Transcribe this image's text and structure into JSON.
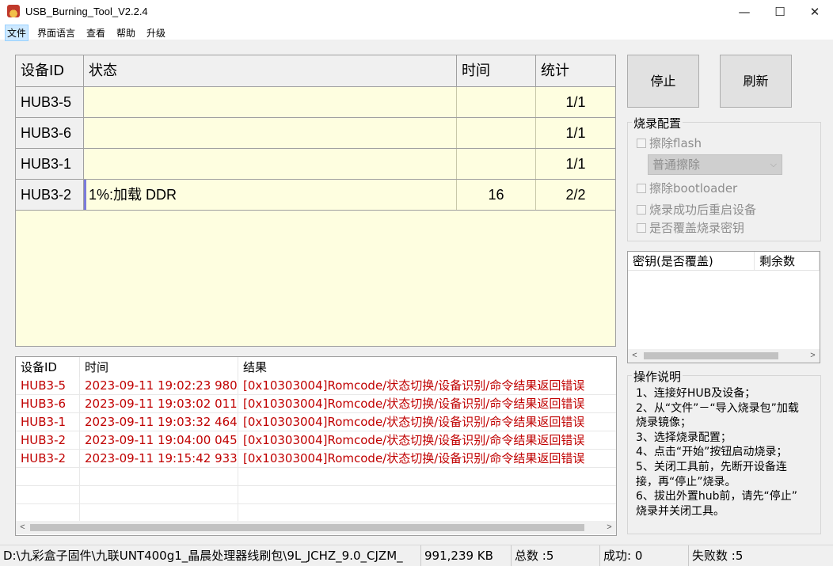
{
  "window": {
    "title": "USB_Burning_Tool_V2.2.4",
    "min_glyph": "—",
    "max_glyph": "☐",
    "close_glyph": "✕"
  },
  "menu": [
    "文件",
    "界面语言",
    "查看",
    "帮助",
    "升级"
  ],
  "device_table": {
    "headers": [
      "设备ID",
      "状态",
      "时间",
      "统计"
    ],
    "rows": [
      {
        "id": "HUB3-5",
        "status": "",
        "time": "",
        "stat": "1/1"
      },
      {
        "id": "HUB3-6",
        "status": "",
        "time": "",
        "stat": "1/1"
      },
      {
        "id": "HUB3-1",
        "status": "",
        "time": "",
        "stat": "1/1"
      },
      {
        "id": "HUB3-2",
        "status": "1%:加载 DDR",
        "time": "16",
        "stat": "2/2"
      }
    ]
  },
  "buttons": {
    "stop": "停止",
    "refresh": "刷新"
  },
  "burn_config": {
    "title": "烧录配置",
    "erase_flash": "擦除flash",
    "erase_mode": "普通擦除",
    "erase_bootloader": "擦除bootloader",
    "reboot_after": "烧录成功后重启设备",
    "overwrite_key": "是否覆盖烧录密钥"
  },
  "key_table": {
    "headers": [
      "密钥(是否覆盖)",
      "剩余数"
    ]
  },
  "instructions": {
    "title": "操作说明",
    "lines": [
      "1、连接好HUB及设备；",
      "2、从“文件”－“导入烧录包”加载",
      "烧录镜像；",
      "3、选择烧录配置；",
      "4、点击“开始”按钮启动烧录；",
      "5、关闭工具前，先断开设备连",
      "接，再“停止”烧录。",
      "6、拔出外置hub前，请先“停止”",
      "烧录并关闭工具。"
    ]
  },
  "log_table": {
    "headers": [
      "设备ID",
      "时间",
      "结果"
    ],
    "rows": [
      {
        "id": "HUB3-5",
        "time": "2023-09-11 19:02:23 980",
        "result": "[0x10303004]Romcode/状态切换/设备识别/命令结果返回错误"
      },
      {
        "id": "HUB3-6",
        "time": "2023-09-11 19:03:02 011",
        "result": "[0x10303004]Romcode/状态切换/设备识别/命令结果返回错误"
      },
      {
        "id": "HUB3-1",
        "time": "2023-09-11 19:03:32 464",
        "result": "[0x10303004]Romcode/状态切换/设备识别/命令结果返回错误"
      },
      {
        "id": "HUB3-2",
        "time": "2023-09-11 19:04:00 045",
        "result": "[0x10303004]Romcode/状态切换/设备识别/命令结果返回错误"
      },
      {
        "id": "HUB3-2",
        "time": "2023-09-11 19:15:42 933",
        "result": "[0x10303004]Romcode/状态切换/设备识别/命令结果返回错误"
      }
    ]
  },
  "status_bar": {
    "path": "D:\\九彩盒子固件\\九联UNT400g1_晶晨处理器线刷包\\9L_JCHZ_9.0_CJZM_",
    "size": "991,239 KB",
    "total": "总数 :5",
    "success": "成功: 0",
    "failed": "失败数 :5"
  },
  "colors": {
    "table_bg": "#fefee0",
    "error_text": "#c00000",
    "selection_marker": "#7b7bd9"
  }
}
